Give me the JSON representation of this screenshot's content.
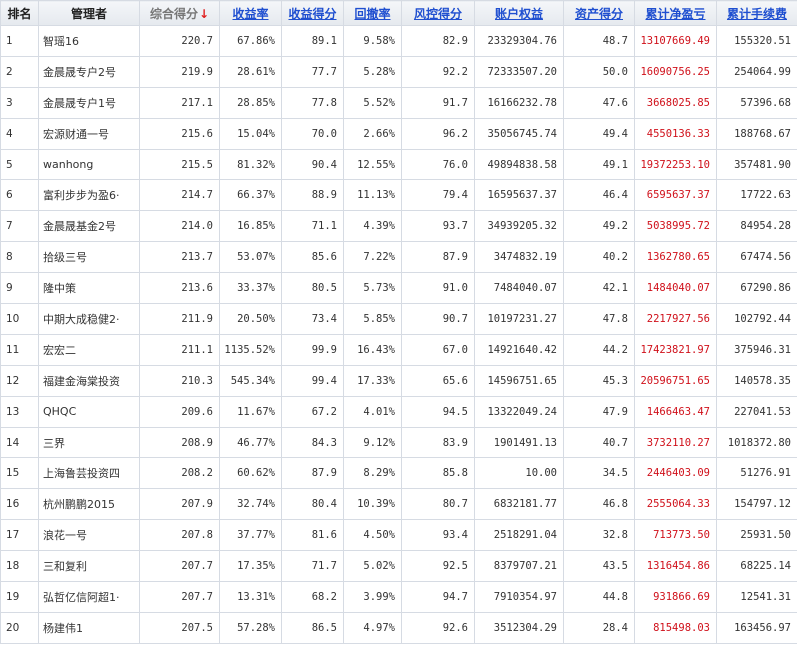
{
  "headers": {
    "rank": "排名",
    "manager": "管理者",
    "total_score": "综合得分",
    "sort_arrow": "↓",
    "return_rate": "收益率",
    "return_score": "收益得分",
    "drawdown": "回撤率",
    "risk_score": "风控得分",
    "equity": "账户权益",
    "asset_score": "资产得分",
    "net_profit": "累计净盈亏",
    "fees": "累计手续费"
  },
  "rows": [
    {
      "rank": "1",
      "name": "智瑶16",
      "total": "220.7",
      "ret": "67.86%",
      "ret_score": "89.1",
      "dd": "9.58%",
      "risk": "82.9",
      "equity": "23329304.76",
      "asset": "48.7",
      "profit": "13107669.49",
      "fee": "155320.51"
    },
    {
      "rank": "2",
      "name": "金晨晟专户2号",
      "total": "219.9",
      "ret": "28.61%",
      "ret_score": "77.7",
      "dd": "5.28%",
      "risk": "92.2",
      "equity": "72333507.20",
      "asset": "50.0",
      "profit": "16090756.25",
      "fee": "254064.99"
    },
    {
      "rank": "3",
      "name": "金晨晟专户1号",
      "total": "217.1",
      "ret": "28.85%",
      "ret_score": "77.8",
      "dd": "5.52%",
      "risk": "91.7",
      "equity": "16166232.78",
      "asset": "47.6",
      "profit": "3668025.85",
      "fee": "57396.68"
    },
    {
      "rank": "4",
      "name": "宏源财通一号",
      "total": "215.6",
      "ret": "15.04%",
      "ret_score": "70.0",
      "dd": "2.66%",
      "risk": "96.2",
      "equity": "35056745.74",
      "asset": "49.4",
      "profit": "4550136.33",
      "fee": "188768.67"
    },
    {
      "rank": "5",
      "name": "wanhong",
      "total": "215.5",
      "ret": "81.32%",
      "ret_score": "90.4",
      "dd": "12.55%",
      "risk": "76.0",
      "equity": "49894838.58",
      "asset": "49.1",
      "profit": "19372253.10",
      "fee": "357481.90"
    },
    {
      "rank": "6",
      "name": "富利步步为盈6·",
      "total": "214.7",
      "ret": "66.37%",
      "ret_score": "88.9",
      "dd": "11.13%",
      "risk": "79.4",
      "equity": "16595637.37",
      "asset": "46.4",
      "profit": "6595637.37",
      "fee": "17722.63"
    },
    {
      "rank": "7",
      "name": "金晨晟基金2号",
      "total": "214.0",
      "ret": "16.85%",
      "ret_score": "71.1",
      "dd": "4.39%",
      "risk": "93.7",
      "equity": "34939205.32",
      "asset": "49.2",
      "profit": "5038995.72",
      "fee": "84954.28"
    },
    {
      "rank": "8",
      "name": "拾级三号",
      "total": "213.7",
      "ret": "53.07%",
      "ret_score": "85.6",
      "dd": "7.22%",
      "risk": "87.9",
      "equity": "3474832.19",
      "asset": "40.2",
      "profit": "1362780.65",
      "fee": "67474.56"
    },
    {
      "rank": "9",
      "name": "隆中策",
      "total": "213.6",
      "ret": "33.37%",
      "ret_score": "80.5",
      "dd": "5.73%",
      "risk": "91.0",
      "equity": "7484040.07",
      "asset": "42.1",
      "profit": "1484040.07",
      "fee": "67290.86"
    },
    {
      "rank": "10",
      "name": "中期大成稳健2·",
      "total": "211.9",
      "ret": "20.50%",
      "ret_score": "73.4",
      "dd": "5.85%",
      "risk": "90.7",
      "equity": "10197231.27",
      "asset": "47.8",
      "profit": "2217927.56",
      "fee": "102792.44"
    },
    {
      "rank": "11",
      "name": "宏宏二",
      "total": "211.1",
      "ret": "1135.52%",
      "ret_score": "99.9",
      "dd": "16.43%",
      "risk": "67.0",
      "equity": "14921640.42",
      "asset": "44.2",
      "profit": "17423821.97",
      "fee": "375946.31"
    },
    {
      "rank": "12",
      "name": "福建金海棠投资",
      "total": "210.3",
      "ret": "545.34%",
      "ret_score": "99.4",
      "dd": "17.33%",
      "risk": "65.6",
      "equity": "14596751.65",
      "asset": "45.3",
      "profit": "20596751.65",
      "fee": "140578.35"
    },
    {
      "rank": "13",
      "name": "QHQC",
      "total": "209.6",
      "ret": "11.67%",
      "ret_score": "67.2",
      "dd": "4.01%",
      "risk": "94.5",
      "equity": "13322049.24",
      "asset": "47.9",
      "profit": "1466463.47",
      "fee": "227041.53"
    },
    {
      "rank": "14",
      "name": "三界",
      "total": "208.9",
      "ret": "46.77%",
      "ret_score": "84.3",
      "dd": "9.12%",
      "risk": "83.9",
      "equity": "1901491.13",
      "asset": "40.7",
      "profit": "3732110.27",
      "fee": "1018372.80"
    },
    {
      "rank": "15",
      "name": "上海鲁芸投资四",
      "total": "208.2",
      "ret": "60.62%",
      "ret_score": "87.9",
      "dd": "8.29%",
      "risk": "85.8",
      "equity": "10.00",
      "asset": "34.5",
      "profit": "2446403.09",
      "fee": "51276.91"
    },
    {
      "rank": "16",
      "name": "杭州鹏鹏2015",
      "total": "207.9",
      "ret": "32.74%",
      "ret_score": "80.4",
      "dd": "10.39%",
      "risk": "80.7",
      "equity": "6832181.77",
      "asset": "46.8",
      "profit": "2555064.33",
      "fee": "154797.12"
    },
    {
      "rank": "17",
      "name": "浪花一号",
      "total": "207.8",
      "ret": "37.77%",
      "ret_score": "81.6",
      "dd": "4.50%",
      "risk": "93.4",
      "equity": "2518291.04",
      "asset": "32.8",
      "profit": "713773.50",
      "fee": "25931.50"
    },
    {
      "rank": "18",
      "name": "三和复利",
      "total": "207.7",
      "ret": "17.35%",
      "ret_score": "71.7",
      "dd": "5.02%",
      "risk": "92.5",
      "equity": "8379707.21",
      "asset": "43.5",
      "profit": "1316454.86",
      "fee": "68225.14"
    },
    {
      "rank": "19",
      "name": "弘哲亿信阿超1·",
      "total": "207.7",
      "ret": "13.31%",
      "ret_score": "68.2",
      "dd": "3.99%",
      "risk": "94.7",
      "equity": "7910354.97",
      "asset": "44.8",
      "profit": "931866.69",
      "fee": "12541.31"
    },
    {
      "rank": "20",
      "name": "杨建伟1",
      "total": "207.5",
      "ret": "57.28%",
      "ret_score": "86.5",
      "dd": "4.97%",
      "risk": "92.6",
      "equity": "3512304.29",
      "asset": "28.4",
      "profit": "815498.03",
      "fee": "163456.97"
    }
  ],
  "colors": {
    "link": "#1f4fd0",
    "negative_profit": "#d0101a",
    "sort_arrow": "#e02020",
    "border": "#d6dbe3"
  }
}
